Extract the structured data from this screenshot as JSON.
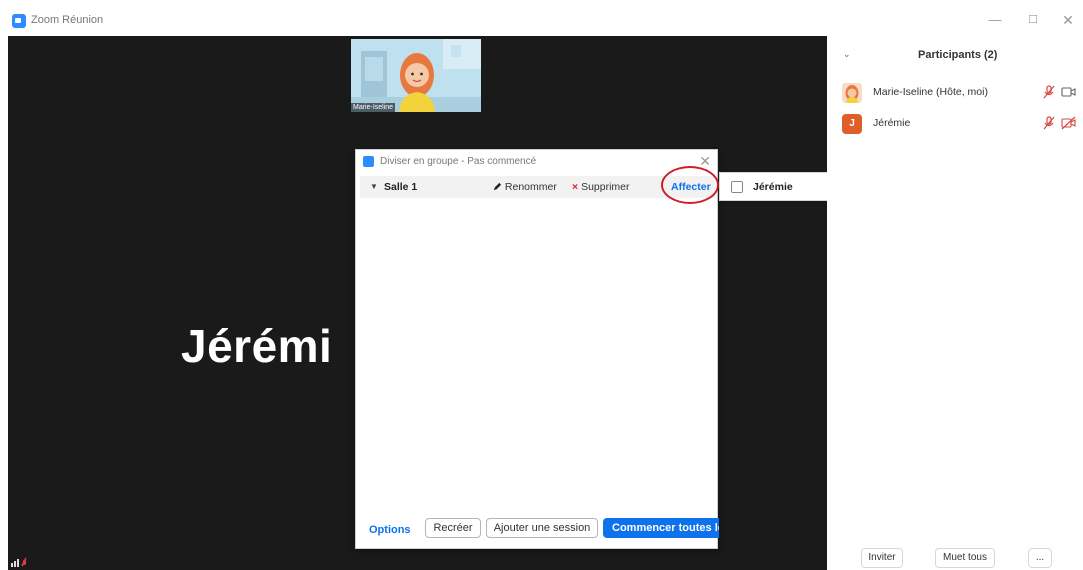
{
  "window": {
    "title": "Zoom Réunion",
    "min_glyph": "—",
    "max_glyph": "☐",
    "close_glyph": "✕"
  },
  "video": {
    "speaker_name": "Jérémi",
    "thumbnail_label": "Marie-Iseline"
  },
  "breakout": {
    "title": "Diviser en groupe - Pas commencé",
    "close_glyph": "✕",
    "room": {
      "arrow": "▼",
      "name": "Salle 1",
      "rename_label": "Renommer",
      "delete_label": "Supprimer",
      "assign_label": "Affecter"
    },
    "footer": {
      "options_label": "Options",
      "recreate_label": "Recréer",
      "add_session_label": "Ajouter une session",
      "start_all_label": "Commencer toutes les sessions"
    }
  },
  "assign_popup": {
    "participant": "Jérémie"
  },
  "participants": {
    "title": "Participants (2)",
    "chevron": "⌄",
    "list": [
      {
        "name": "Marie-Iseline (Hôte, moi)",
        "initial": "",
        "avatar_color": "#f1c9a9"
      },
      {
        "name": "Jérémie",
        "initial": "J",
        "avatar_color": "#e05f28"
      }
    ],
    "invite_label": "Inviter",
    "mute_all_label": "Muet tous",
    "more_label": "..."
  },
  "colors": {
    "accent": "#0e72ed",
    "highlight_circle": "#d11d2a",
    "muted_icon": "#d9453f"
  }
}
